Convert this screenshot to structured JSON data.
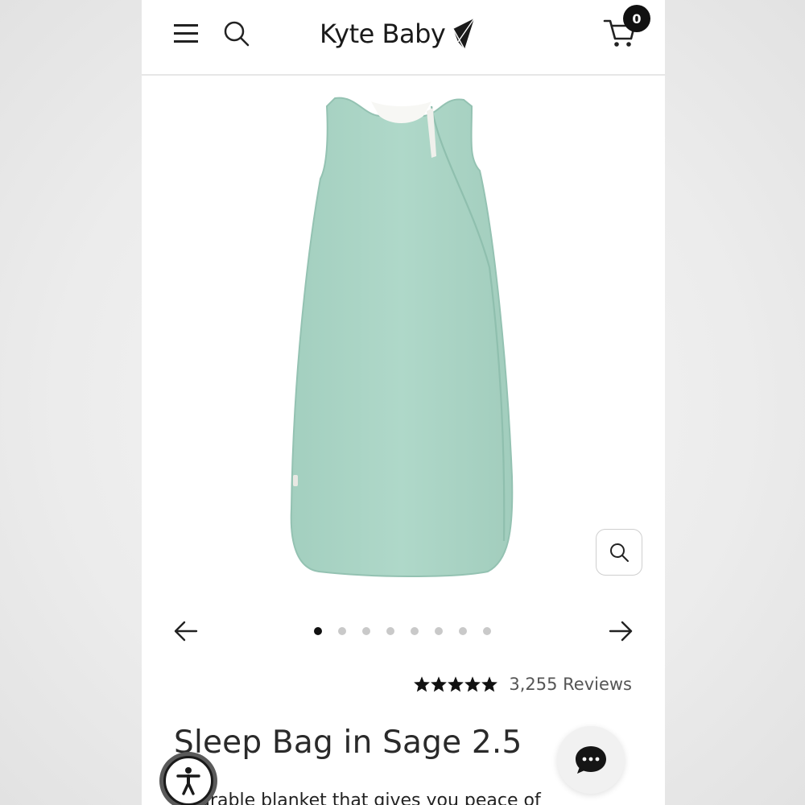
{
  "header": {
    "menu_icon": "hamburger-menu-icon",
    "search_icon": "search-icon",
    "logo_text": "Kyte Baby",
    "logo_icon": "kite-logo-icon",
    "cart_icon": "shopping-cart-icon",
    "cart_count": "0"
  },
  "gallery": {
    "product_color": "#a9d3c4",
    "zoom_icon": "zoom-search-icon",
    "prev_icon": "arrow-left-icon",
    "next_icon": "arrow-right-icon",
    "total_slides": 8,
    "active_slide": 1
  },
  "rating": {
    "stars": 5,
    "reviews_label": "3,255 Reviews"
  },
  "product": {
    "title": "Sleep Bag in Sage 2.5",
    "description": "wearable blanket that gives you peace of"
  },
  "widgets": {
    "chat_icon": "chat-bubble-icon",
    "accessibility_icon": "accessibility-person-icon"
  }
}
